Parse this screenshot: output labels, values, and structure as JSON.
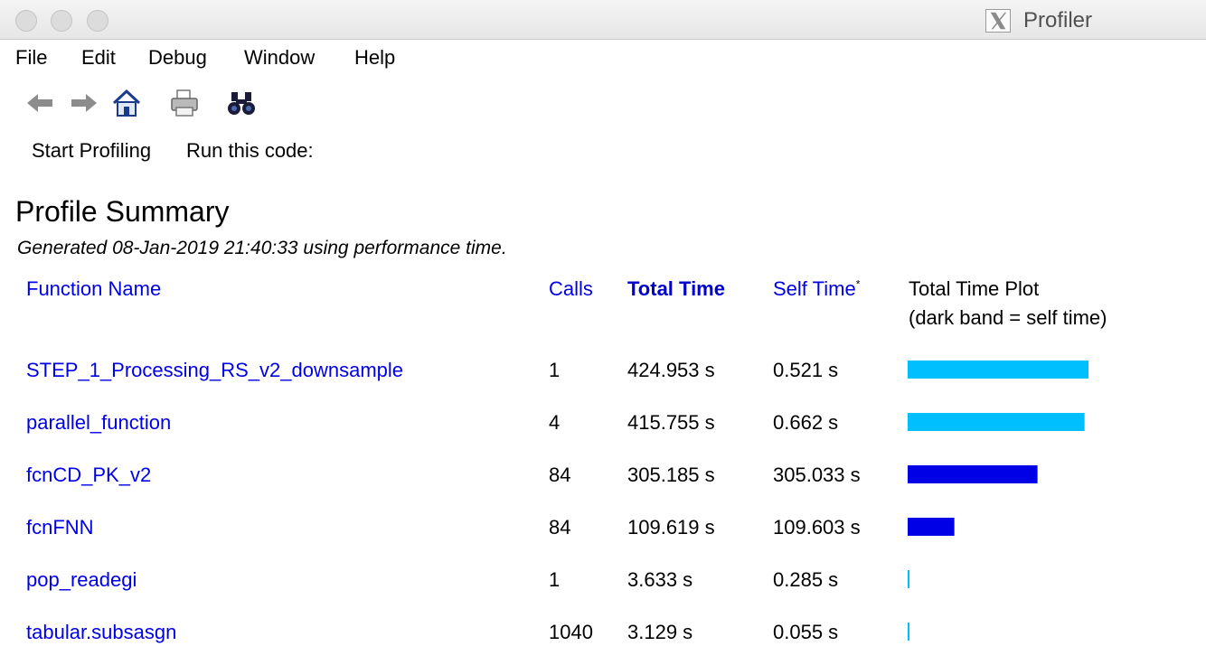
{
  "window": {
    "title": "Profiler"
  },
  "menu": [
    "File",
    "Edit",
    "Debug",
    "Window",
    "Help"
  ],
  "toolbar": {
    "icons": [
      "back-arrow-icon",
      "forward-arrow-icon",
      "home-icon",
      "print-icon",
      "find-icon"
    ]
  },
  "actions": {
    "start_profiling": "Start Profiling",
    "run_code_label": "Run this code:"
  },
  "summary": {
    "title": "Profile Summary",
    "generated": "Generated 08-Jan-2019 21:40:33 using performance time."
  },
  "columns": {
    "function_name": "Function Name",
    "calls": "Calls",
    "total_time": "Total Time",
    "self_time": "Self Time",
    "self_time_mark": "*",
    "plot": "Total Time Plot",
    "plot_note": "(dark band = self time)"
  },
  "colors": {
    "link": "#0000e6",
    "total_band": "#00bfff",
    "self_band": "#0000e6"
  },
  "rows": [
    {
      "name": "STEP_1_Processing_RS_v2_downsample",
      "calls": "1",
      "total_time": "424.953 s",
      "self_time": "0.521 s",
      "total_s": 424.953,
      "self_s": 0.521
    },
    {
      "name": "parallel_function",
      "calls": "4",
      "total_time": "415.755 s",
      "self_time": "0.662 s",
      "total_s": 415.755,
      "self_s": 0.662
    },
    {
      "name": "fcnCD_PK_v2",
      "calls": "84",
      "total_time": "305.185 s",
      "self_time": "305.033 s",
      "total_s": 305.185,
      "self_s": 305.033
    },
    {
      "name": "fcnFNN",
      "calls": "84",
      "total_time": "109.619 s",
      "self_time": "109.603 s",
      "total_s": 109.619,
      "self_s": 109.603
    },
    {
      "name": "pop_readegi",
      "calls": "1",
      "total_time": "3.633 s",
      "self_time": "0.285 s",
      "total_s": 3.633,
      "self_s": 0.285
    },
    {
      "name": "tabular.subsasgn",
      "calls": "1040",
      "total_time": "3.129 s",
      "self_time": "0.055 s",
      "total_s": 3.129,
      "self_s": 0.055
    }
  ]
}
